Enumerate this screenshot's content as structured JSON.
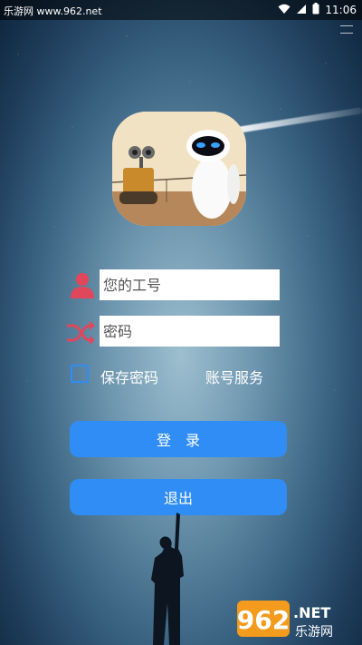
{
  "status_bar": {
    "site_watermark": "乐游网 www.962.net",
    "time": "11:06"
  },
  "login_form": {
    "employee_id_placeholder": "您的工号",
    "password_placeholder": "密码",
    "save_password_label": "保存密码",
    "account_service_label": "账号服务",
    "login_button_label": "登　录",
    "exit_button_label": "退出"
  },
  "logo": {
    "brand_text": "962",
    "brand_suffix": ".NET",
    "brand_chinese": "乐游网"
  },
  "colors": {
    "accent": "#2f8df5",
    "user_icon": "#e0475a",
    "shuffle_icon": "#e0475a"
  }
}
